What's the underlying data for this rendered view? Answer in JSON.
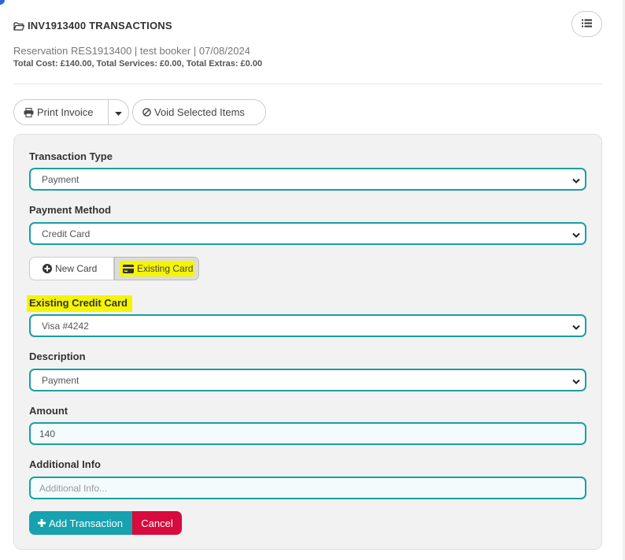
{
  "header": {
    "title": "INV1913400 TRANSACTIONS",
    "subtitle": "Reservation RES1913400 | test booker | 07/08/2024",
    "totals": "Total Cost: £140.00, Total Services: £0.00, Total Extras: £0.00"
  },
  "toolbar": {
    "print_label": "Print Invoice",
    "void_label": "Void Selected Items"
  },
  "form": {
    "transaction_type": {
      "label": "Transaction Type",
      "value": "Payment"
    },
    "payment_method": {
      "label": "Payment Method",
      "value": "Credit Card"
    },
    "card_toggle": {
      "new_label": "New Card",
      "existing_label": "Existing Card",
      "selected": "Existing Card"
    },
    "existing_card": {
      "label": "Existing Credit Card",
      "value": "Visa #4242"
    },
    "description": {
      "label": "Description",
      "value": "Payment"
    },
    "amount": {
      "label": "Amount",
      "value": "140"
    },
    "additional_info": {
      "label": "Additional Info",
      "placeholder": "Additional Info..."
    }
  },
  "actions": {
    "add_label": "Add Transaction",
    "cancel_label": "Cancel"
  },
  "colors": {
    "accent": "#1aa0a0",
    "add_button": "#17a2b0",
    "cancel_button": "#d70b3e",
    "highlight": "#f5f500"
  },
  "icons": [
    "folder-open-icon",
    "list-icon",
    "printer-icon",
    "caret-down-icon",
    "ban-icon",
    "plus-circle-icon",
    "credit-card-icon",
    "chevron-down-icon",
    "plus-icon"
  ]
}
